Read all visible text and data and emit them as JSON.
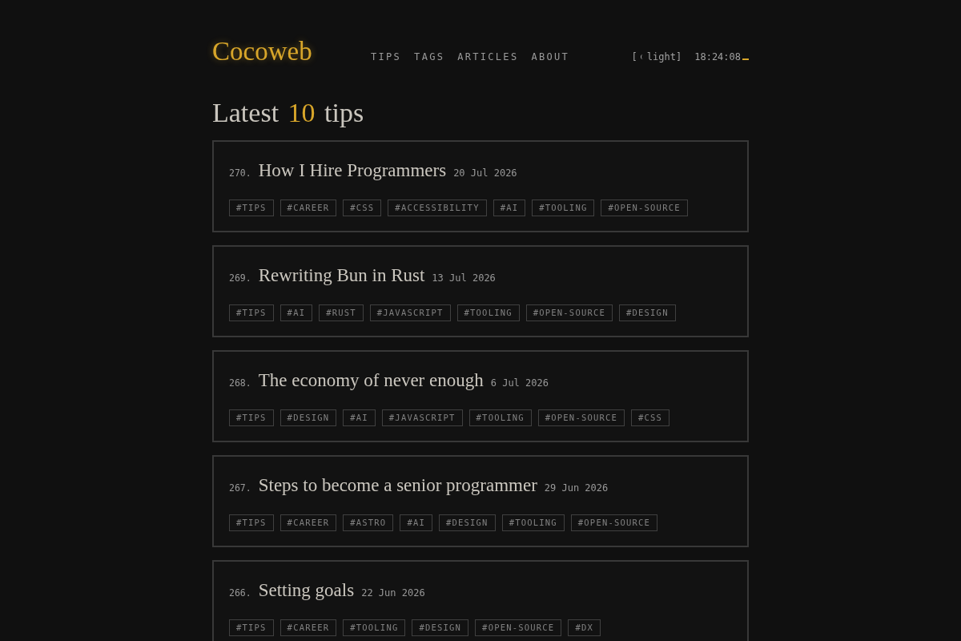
{
  "header": {
    "logo": "Cocoweb",
    "nav": [
      "TIPS",
      "TAGS",
      "ARTICLES",
      "ABOUT"
    ],
    "theme_toggle": {
      "open": "[",
      "label": "light",
      "close": "]"
    },
    "clock": "18:24:08"
  },
  "heading": {
    "before": "Latest",
    "count": "10",
    "after": "tips"
  },
  "tips": [
    {
      "number": "270.",
      "title": "How I Hire Programmers",
      "date": "20 Jul 2026",
      "tags": [
        "#TIPS",
        "#CAREER",
        "#CSS",
        "#ACCESSIBILITY",
        "#AI",
        "#TOOLING",
        "#OPEN-SOURCE"
      ]
    },
    {
      "number": "269.",
      "title": "Rewriting Bun in Rust",
      "date": "13 Jul 2026",
      "tags": [
        "#TIPS",
        "#AI",
        "#RUST",
        "#JAVASCRIPT",
        "#TOOLING",
        "#OPEN-SOURCE",
        "#DESIGN"
      ]
    },
    {
      "number": "268.",
      "title": "The economy of never enough",
      "date": "6 Jul 2026",
      "tags": [
        "#TIPS",
        "#DESIGN",
        "#AI",
        "#JAVASCRIPT",
        "#TOOLING",
        "#OPEN-SOURCE",
        "#CSS"
      ]
    },
    {
      "number": "267.",
      "title": "Steps to become a senior programmer",
      "date": "29 Jun 2026",
      "tags": [
        "#TIPS",
        "#CAREER",
        "#ASTRO",
        "#AI",
        "#DESIGN",
        "#TOOLING",
        "#OPEN-SOURCE"
      ]
    },
    {
      "number": "266.",
      "title": "Setting goals",
      "date": "22 Jun 2026",
      "tags": [
        "#TIPS",
        "#CAREER",
        "#TOOLING",
        "#DESIGN",
        "#OPEN-SOURCE",
        "#DX"
      ]
    }
  ]
}
